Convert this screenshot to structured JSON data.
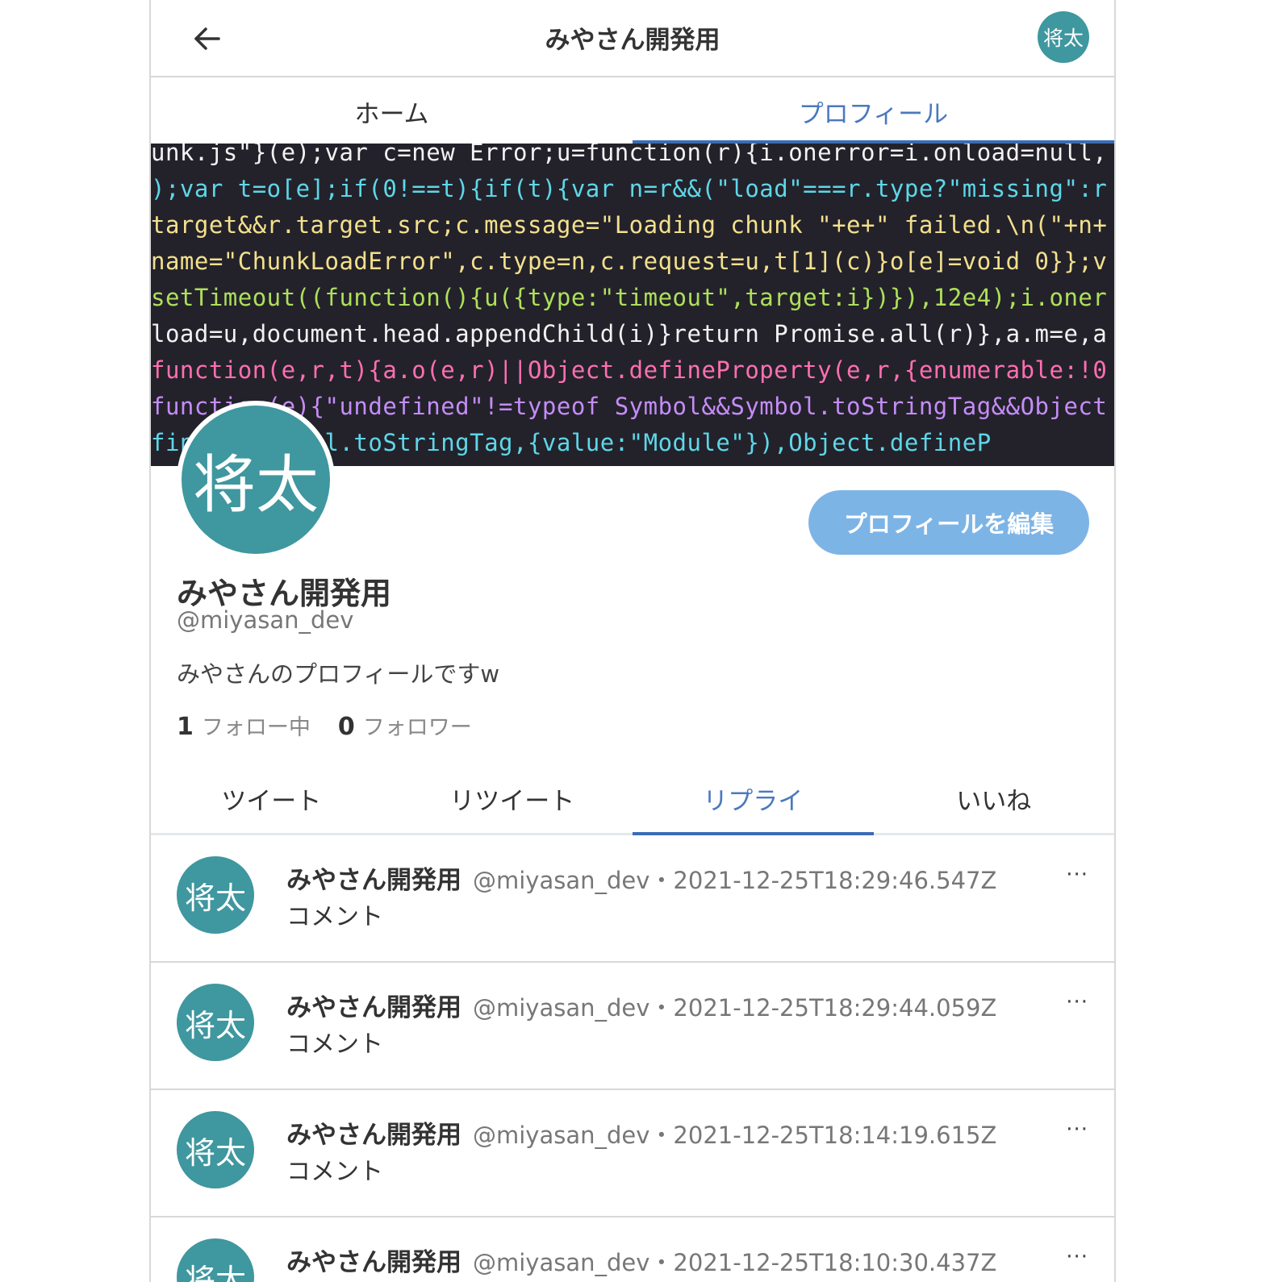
{
  "header": {
    "title": "みやさん開発用",
    "avatar_text": "将太"
  },
  "main_nav": {
    "tabs": [
      {
        "label": "ホーム"
      },
      {
        "label": "プロフィール"
      }
    ]
  },
  "banner": {
    "code_lines": [
      "unk.js\"}(e);var c=new Error;u=function(r){i.onerror=i.onload=null,",
      ");var t=o[e];if(0!==t){if(t){var n=r&&(\"load\"===r.type?\"missing\":r",
      "target&&r.target.src;c.message=\"Loading chunk \"+e+\" failed.\\n(\"+n+",
      "name=\"ChunkLoadError\",c.type=n,c.request=u,t[1](c)}o[e]=void 0}};v",
      "setTimeout((function(){u({type:\"timeout\",target:i})}),12e4);i.oner",
      "load=u,document.head.appendChild(i)}return Promise.all(r)},a.m=e,a",
      "function(e,r,t){a.o(e,r)||Object.defineProperty(e,r,{enumerable:!0",
      "function(e){\"undefined\"!=typeof Symbol&&Symbol.toStringTag&&Object",
      "fine(e,Symbol.toStringTag,{value:\"Module\"}),Object.defineP"
    ]
  },
  "profile": {
    "avatar_text": "将太",
    "edit_label": "プロフィールを編集",
    "name": "みやさん開発用",
    "handle": "@miyasan_dev",
    "bio": "みやさんのプロフィールですw",
    "following_count": "1",
    "following_label": "フォロー中",
    "followers_count": "0",
    "followers_label": "フォロワー"
  },
  "sub_tabs": [
    {
      "label": "ツイート"
    },
    {
      "label": "リツイート"
    },
    {
      "label": "リプライ"
    },
    {
      "label": "いいね"
    }
  ],
  "tweets": [
    {
      "avatar": "将太",
      "name": "みやさん開発用",
      "handle": "@miyasan_dev",
      "date": "・2021-12-25T18:29:46.547Z",
      "text": "コメント",
      "more": "···"
    },
    {
      "avatar": "将太",
      "name": "みやさん開発用",
      "handle": "@miyasan_dev",
      "date": "・2021-12-25T18:29:44.059Z",
      "text": "コメント",
      "more": "···"
    },
    {
      "avatar": "将太",
      "name": "みやさん開発用",
      "handle": "@miyasan_dev",
      "date": "・2021-12-25T18:14:19.615Z",
      "text": "コメント",
      "more": "···"
    },
    {
      "avatar": "将太",
      "name": "みやさん開発用",
      "handle": "@miyasan_dev",
      "date": "・2021-12-25T18:10:30.437Z",
      "text": "",
      "more": "···"
    }
  ],
  "colors": {
    "accent": "#4a78bf",
    "avatar_bg": "#3f979f",
    "edit_button": "#7db4e6",
    "banner_bg": "#23222b"
  }
}
